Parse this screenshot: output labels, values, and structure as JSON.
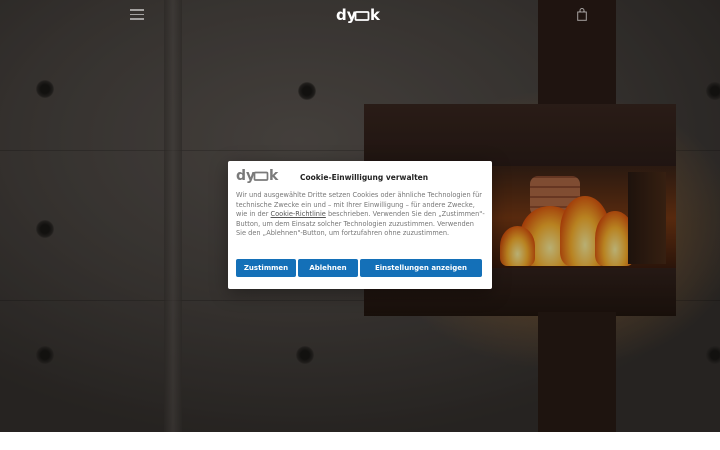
{
  "header": {
    "logo_text": "dyook",
    "menu_icon": "hamburger-menu-icon",
    "cart_icon": "shopping-bag-icon"
  },
  "hero": {
    "image_subject": "concrete-wall-with-fireplace-stove"
  },
  "cookie_dialog": {
    "logo_text": "dyook",
    "title": "Cookie-Einwilligung verwalten",
    "body_part1": "Wir und ausgewählte Dritte setzen Cookies oder ähnliche Technologien für technische Zwecke ein und – mit Ihrer Einwilligung – für andere Zwecke, wie in der ",
    "link_text": "Cookie-Richtlinie",
    "body_part2": " beschrieben. Verwenden Sie den „Zustimmen\"-Button, um dem Einsatz solcher Technologien zuzustimmen. Verwenden Sie den „Ablehnen\"-Button, um fortzufahren ohne zuzustimmen.",
    "buttons": {
      "accept": "Zustimmen",
      "decline": "Ablehnen",
      "settings": "Einstellungen anzeigen"
    }
  },
  "colors": {
    "button_blue": "#1470b8",
    "dialog_bg": "#ffffff",
    "logo_grey": "#7a7a7a"
  }
}
